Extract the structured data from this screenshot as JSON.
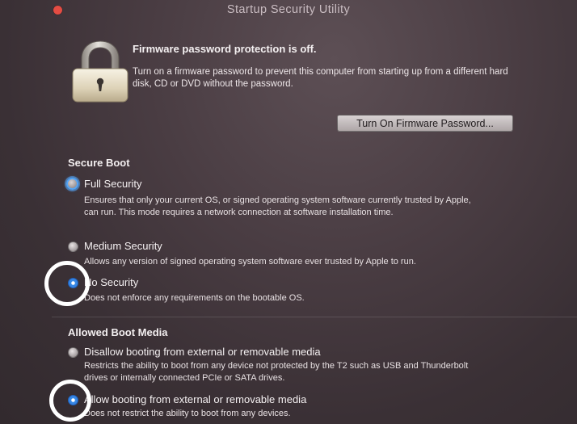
{
  "window": {
    "title": "Startup Security Utility"
  },
  "firmware": {
    "heading": "Firmware password protection is off.",
    "description": "Turn on a firmware password to prevent this computer from starting up from a different hard disk, CD or DVD without the password.",
    "button_label": "Turn On Firmware Password..."
  },
  "secure_boot": {
    "heading": "Secure Boot",
    "options": [
      {
        "label": "Full Security",
        "description": "Ensures that only your current OS, or signed operating system software currently trusted by Apple, can run. This mode requires a network connection at software installation time.",
        "state": "unselected-focused"
      },
      {
        "label": "Medium Security",
        "description": "Allows any version of signed operating system software ever trusted by Apple to run.",
        "state": "unselected"
      },
      {
        "label": "No Security",
        "description": "Does not enforce any requirements on the bootable OS.",
        "state": "selected"
      }
    ]
  },
  "boot_media": {
    "heading": "Allowed Boot Media",
    "options": [
      {
        "label": "Disallow booting from external or removable media",
        "description": "Restricts the ability to boot from any device not protected by the T2 such as USB and Thunderbolt drives or internally connected PCIe or SATA drives.",
        "state": "unselected"
      },
      {
        "label": "Allow booting from external or removable media",
        "description": "Does not restrict the ability to boot from any devices.",
        "state": "selected"
      }
    ]
  },
  "colors": {
    "accent": "#3a8ce8",
    "close_button": "#e44c43",
    "annotation": "#ffffff"
  },
  "icons": {
    "lock": "padlock-closed-icon"
  }
}
